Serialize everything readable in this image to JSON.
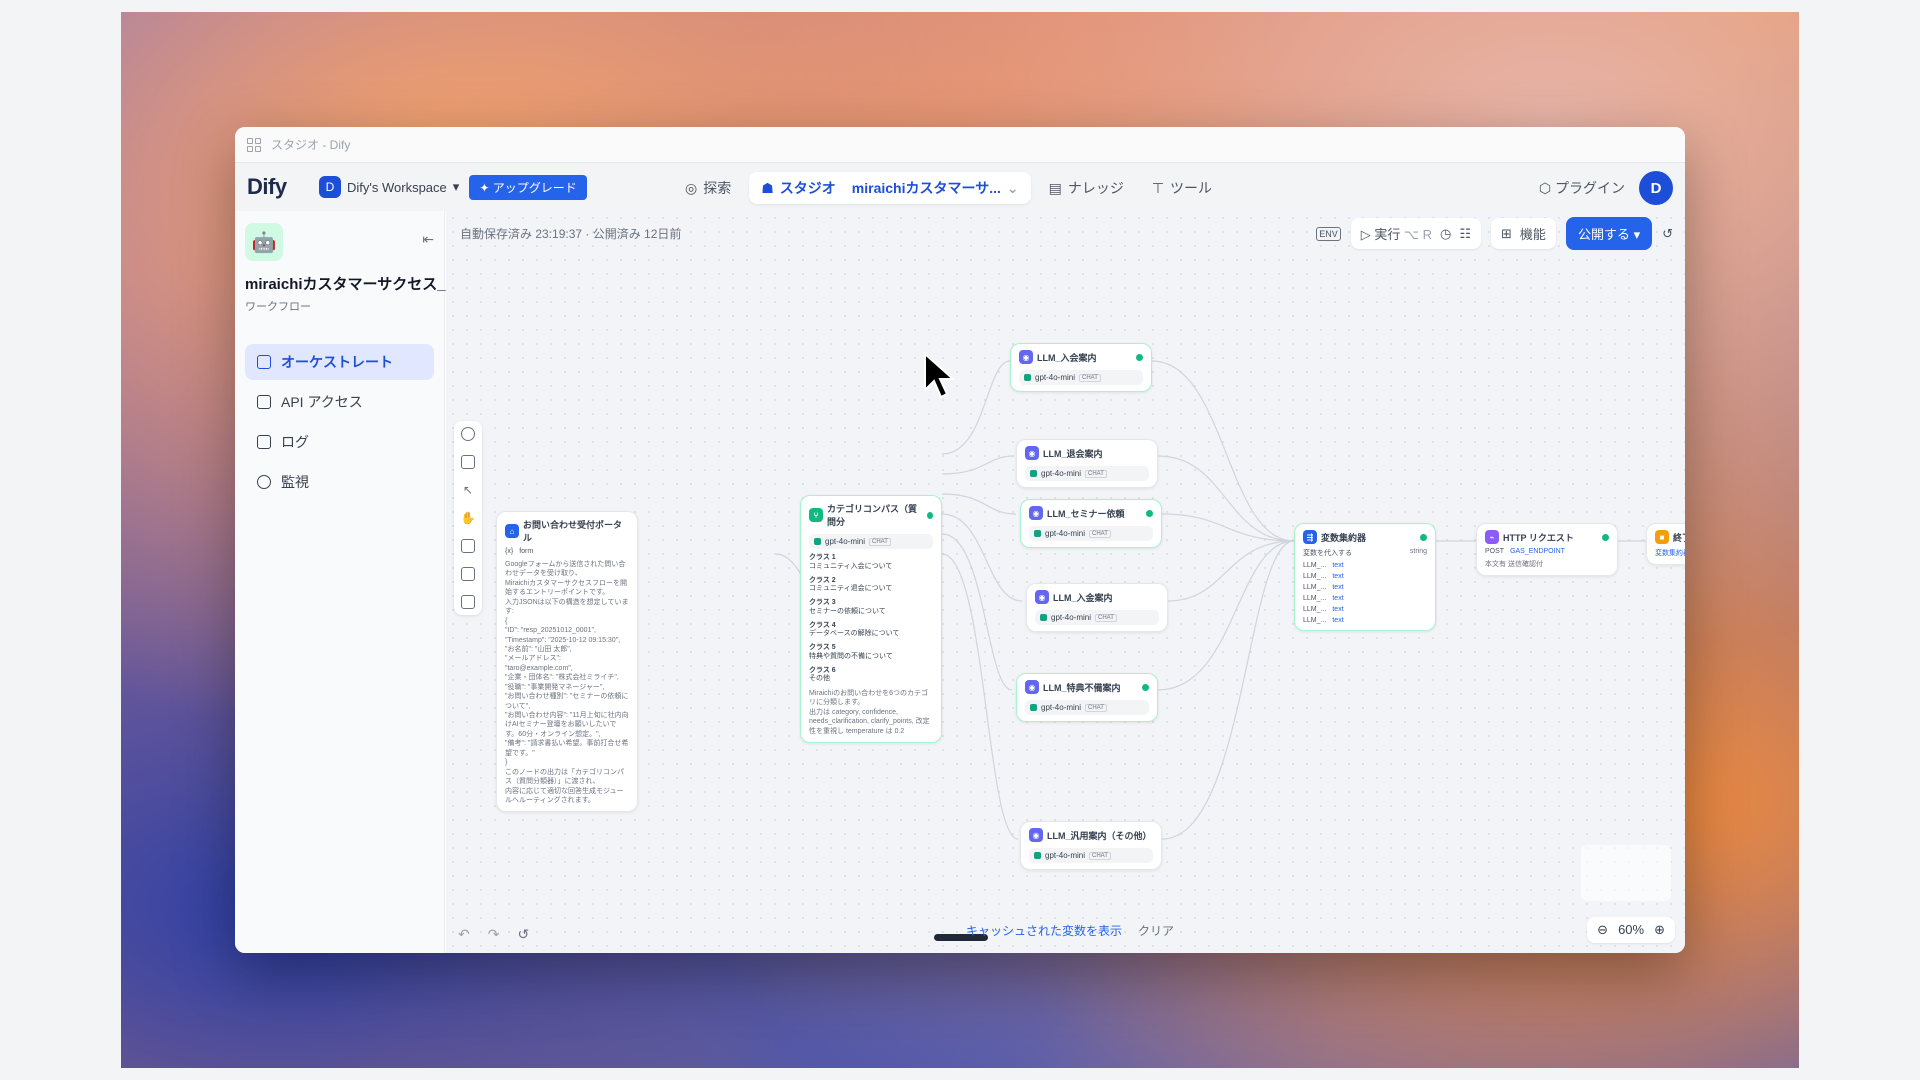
{
  "window": {
    "title": "スタジオ - Dify"
  },
  "header": {
    "logo": "Dify",
    "workspace_initial": "D",
    "workspace": "Dify's Workspace",
    "upgrade": "アップグレード",
    "nav": {
      "explore": "探索",
      "studio": "スタジオ",
      "app": "miraichiカスタマーサ...",
      "knowledge": "ナレッジ",
      "tools": "ツール"
    },
    "plugins": "プラグイン",
    "user_initial": "D"
  },
  "sidebar": {
    "app_name": "miraichiカスタマーサクセス_",
    "app_type": "ワークフロー",
    "items": [
      {
        "label": "オーケストレート"
      },
      {
        "label": "API アクセス"
      },
      {
        "label": "ログ"
      },
      {
        "label": "監視"
      }
    ]
  },
  "canvas": {
    "autosave": "自動保存済み 23:19:37 · 公開済み 12日前",
    "toolbar": {
      "env": "ENV",
      "run": "実行",
      "run_shortcut": "⌥ R",
      "features": "機能",
      "publish": "公開する"
    },
    "cache_text": "キャッシュされた変数を表示",
    "clear": "クリア",
    "zoom": "60%"
  },
  "nodes": {
    "start": {
      "title": "お問い合わせ受付ポータル",
      "var": "form",
      "body": "Googleフォームから送信された問い合わせデータを受け取り、\nMiraichiカスタマーサクセスフローを開始するエントリーポイントです。\n入力JSONは以下の構造を想定しています:\n{\n\"ID\": \"resp_20251012_0001\",\n\"Timestamp\": \"2025-10-12 09:15:30\",\n\"お名前\": \"山田 太郎\",\n\"メールアドレス\": \"taro@example.com\",\n\"企業・団体名\": \"株式会社ミライチ\",\n\"役職\": \"事業開発マネージャー\",\n\"お問い合わせ種別\": \"セミナーの依頼について\",\n\"お問い合わせ内容\": \"11月上旬に社内向けAIセミナー登壇をお願いしたいです。60分・オンライン想定。\",\n\"備考\": \"請求書払い希望。事前打合せ希望です。\"\n}\nこのノードの出力は「カテゴリコンパス（質問分類器）」に渡され、\n内容に応じて適切な回答生成モジュールへルーティングされます。"
    },
    "classifier": {
      "title": "カテゴリコンパス（質問分",
      "model": "gpt-4o-mini",
      "chat": "CHAT",
      "classes": [
        {
          "name": "クラス 1",
          "desc": "コミュニティ入会について"
        },
        {
          "name": "クラス 2",
          "desc": "コミュニティ退会について"
        },
        {
          "name": "クラス 3",
          "desc": "セミナーの依頼について"
        },
        {
          "name": "クラス 4",
          "desc": "データベースの解除について"
        },
        {
          "name": "クラス 5",
          "desc": "特典や質問の不備について"
        },
        {
          "name": "クラス 6",
          "desc": "その他"
        }
      ],
      "note": "Miraichiのお問い合わせを6つのカテゴリに分類します。\n出力は category, confidence, needs_clarification, clarify_points, 改定性を重視し temperature は 0.2"
    },
    "llm": [
      {
        "title": "LLM_入会案内",
        "model": "gpt-4o-mini",
        "chat": "CHAT"
      },
      {
        "title": "LLM_退会案内",
        "model": "gpt-4o-mini",
        "chat": "CHAT"
      },
      {
        "title": "LLM_セミナー依頼",
        "model": "gpt-4o-mini",
        "chat": "CHAT"
      },
      {
        "title": "LLM_入金案内",
        "model": "gpt-4o-mini",
        "chat": "CHAT"
      },
      {
        "title": "LLM_特典不備案内",
        "model": "gpt-4o-mini",
        "chat": "CHAT"
      },
      {
        "title": "LLM_汎用案内（その他）",
        "model": "gpt-4o-mini",
        "chat": "CHAT"
      }
    ],
    "aggregator": {
      "title": "変数集約器",
      "label": "変数を代入する",
      "type": "string",
      "rows": [
        {
          "src": "LLM_...",
          "var": "text"
        },
        {
          "src": "LLM_...",
          "var": "text"
        },
        {
          "src": "LLM_...",
          "var": "text"
        },
        {
          "src": "LLM_...",
          "var": "text"
        },
        {
          "src": "LLM_...",
          "var": "text"
        },
        {
          "src": "LLM_...",
          "var": "text"
        }
      ]
    },
    "http": {
      "title": "HTTP リクエスト",
      "method": "POST",
      "endpoint": "GAS_ENDPOINT",
      "sub": "本文有 送信確認付"
    },
    "end": {
      "title": "終了",
      "out": "変数集約器 output"
    }
  }
}
